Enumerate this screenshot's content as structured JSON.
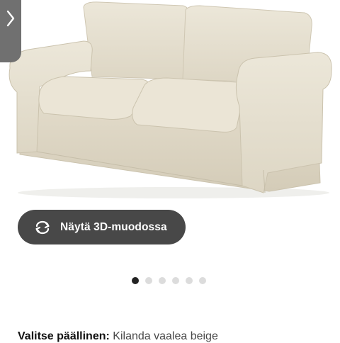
{
  "gallery": {
    "image_alt": "sofa-product-image",
    "view_3d_label": "Näytä 3D-muodossa",
    "dot_count": 6,
    "active_index": 0
  },
  "nav": {
    "prev_icon": "chevron-right-icon"
  },
  "cover": {
    "label": "Valitse päällinen:",
    "value": "Kilanda vaalea beige"
  },
  "colors": {
    "button_bg": "#484848",
    "tab_bg": "#707070",
    "dot_active": "#222222",
    "dot_inactive": "#dcdcdc",
    "fabric": "#e6e0d0"
  }
}
